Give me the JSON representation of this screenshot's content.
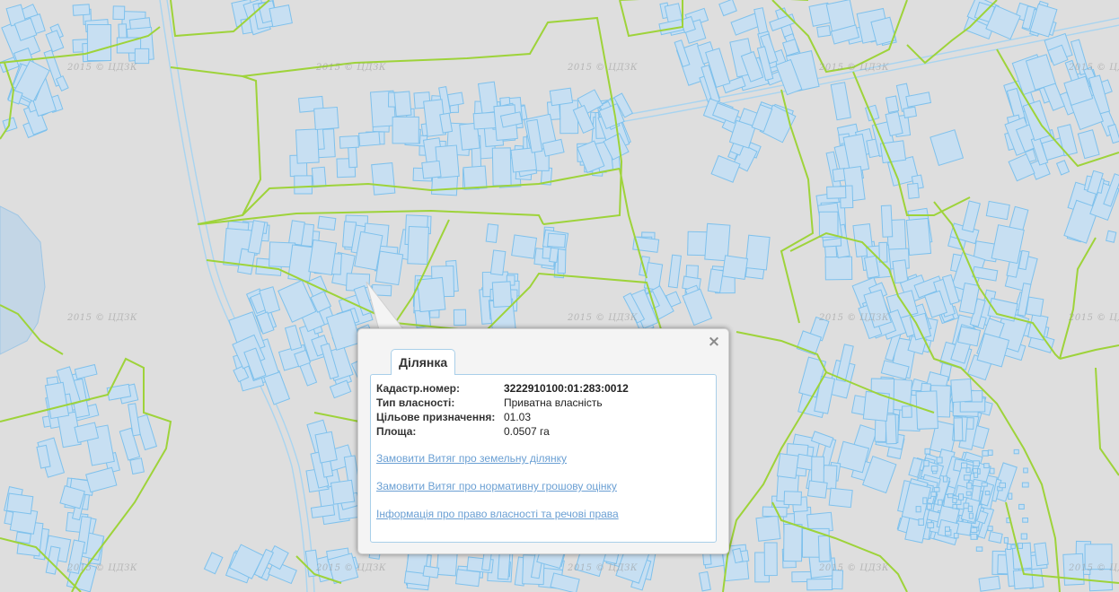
{
  "watermark": "2015 © ЦДЗК",
  "colors": {
    "background": "#dedede",
    "parcel_boundary": "#9ed33a",
    "building_fill": "#c7dff2",
    "building_stroke": "#7fc1ec",
    "road": "#a8d4f0",
    "popup_border": "#a9cfe9",
    "link": "#6a9fd3"
  },
  "popup": {
    "tab_label": "Ділянка",
    "close_icon": "close-icon",
    "fields": [
      {
        "label": "Кадастр.номер:",
        "value": "3222910100:01:283:0012"
      },
      {
        "label": "Тип власності:",
        "value": "Приватна власність"
      },
      {
        "label": "Цільове призначення:",
        "value": "01.03"
      },
      {
        "label": "Площа:",
        "value": "0.0507 га"
      }
    ],
    "links": [
      "Замовити Витяг про земельну ділянку",
      "Замовити Витяг про нормативну грошову оцінку",
      "Інформація про право власності та речові права"
    ]
  }
}
